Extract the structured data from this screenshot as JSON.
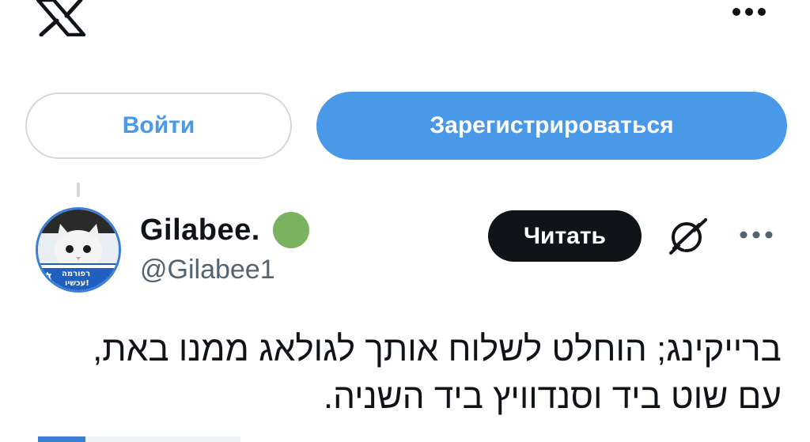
{
  "app": {
    "logo_icon": "x-logo-icon",
    "menu_icon": "more-horizontal-icon"
  },
  "auth": {
    "login_label": "Войти",
    "signup_label": "Зарегистрироваться"
  },
  "tweet": {
    "author": {
      "display_name": "Gilabee.",
      "handle": "@Gilabee1",
      "status_dot_color": "#7ab260",
      "avatar_icon": "cat-avatar-image",
      "avatar_banner_text": "רפורמה עכשיו!"
    },
    "follow_label": "Читать",
    "grok_icon": "grok-icon",
    "more_icon": "more-horizontal-icon",
    "text_lines": [
      "ברייקינג; הוחלט לשלוח אותך לגולאג ממנו באת,",
      "עם שוט ביד וסנדוויץ ביד השניה."
    ]
  },
  "colors": {
    "accent": "#4a99e9",
    "border": "#cfd9de",
    "text": "#0f1419",
    "muted": "#536471"
  }
}
